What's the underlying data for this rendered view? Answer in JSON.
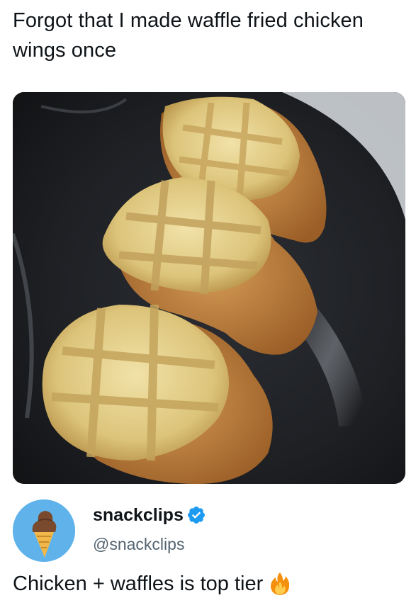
{
  "quote_tweet": {
    "text": "Forgot that I made waffle fried chicken\nwings once"
  },
  "media": {
    "description_icon": "photo"
  },
  "author": {
    "display_name": "snackclips",
    "handle": "@snackclips",
    "verified": true,
    "avatar_icon": "ice-cream-cone-icon",
    "avatar_bg": "#5fb3ea"
  },
  "tweet": {
    "text": "Chicken + waffles is top tier",
    "emoji_icon": "fire-icon"
  },
  "colors": {
    "text_primary": "#0f1419",
    "text_secondary": "#536471",
    "verified_blue": "#1d9bf0"
  }
}
